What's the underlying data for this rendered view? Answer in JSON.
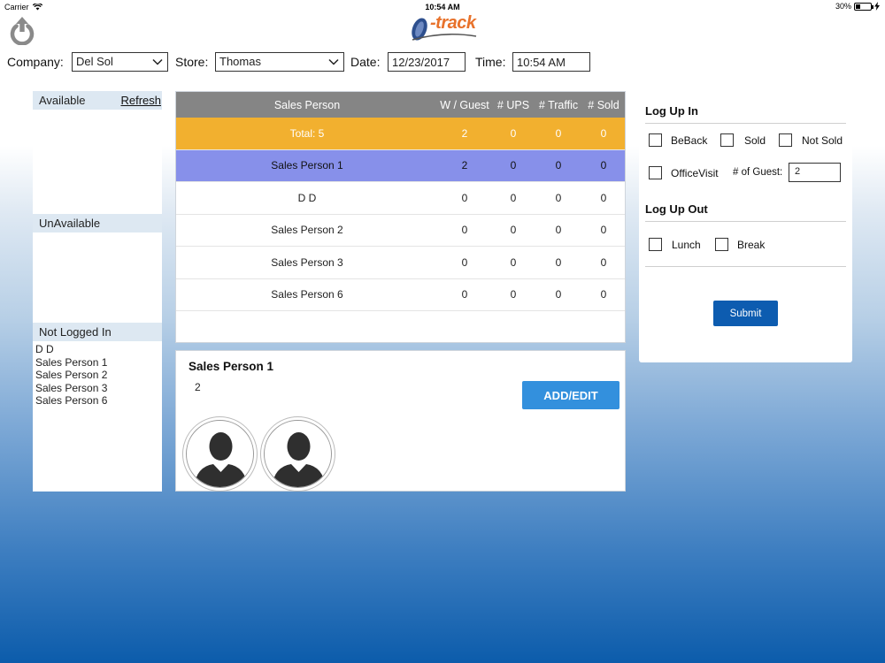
{
  "status_bar": {
    "carrier": "Carrier",
    "time": "10:54 AM",
    "battery": "30%",
    "battery_level": 0.3
  },
  "logo": {
    "text": "-track"
  },
  "filters": {
    "company_label": "Company:",
    "company_value": "Del Sol",
    "store_label": "Store:",
    "store_value": "Thomas",
    "date_label": "Date:",
    "date_value": "12/23/2017",
    "time_label": "Time:",
    "time_value": "10:54 AM"
  },
  "left_panel": {
    "available_label": "Available",
    "refresh_label": "Refresh",
    "unavailable_label": "UnAvailable",
    "not_logged_in_label": "Not Logged In",
    "not_logged_in": [
      "D D",
      "Sales Person 1",
      "Sales Person 2",
      "Sales Person 3",
      "Sales Person 6"
    ]
  },
  "table": {
    "headers": {
      "name": "Sales Person",
      "w_guest": "W / Guest",
      "ups": "# UPS",
      "traffic": "# Traffic",
      "sold": "# Sold"
    },
    "total": {
      "name": "Total: 5",
      "w_guest": "2",
      "ups": "0",
      "traffic": "0",
      "sold": "0"
    },
    "rows": [
      {
        "name": "Sales Person 1",
        "w_guest": "2",
        "ups": "0",
        "traffic": "0",
        "sold": "0"
      },
      {
        "name": "D D",
        "w_guest": "0",
        "ups": "0",
        "traffic": "0",
        "sold": "0"
      },
      {
        "name": "Sales Person 2",
        "w_guest": "0",
        "ups": "0",
        "traffic": "0",
        "sold": "0"
      },
      {
        "name": "Sales Person 3",
        "w_guest": "0",
        "ups": "0",
        "traffic": "0",
        "sold": "0"
      },
      {
        "name": "Sales Person 6",
        "w_guest": "0",
        "ups": "0",
        "traffic": "0",
        "sold": "0"
      }
    ]
  },
  "detail": {
    "title": "Sales Person 1",
    "count": "2",
    "add_edit_label": "ADD/EDIT"
  },
  "right_panel": {
    "log_up_in_label": "Log Up In",
    "beback_label": "BeBack",
    "sold_label": "Sold",
    "not_sold_label": "Not Sold",
    "office_visit_label": "OfficeVisit",
    "guest_label": "# of Guest:",
    "guest_value": "2",
    "log_up_out_label": "Log Up Out",
    "lunch_label": "Lunch",
    "break_label": "Break",
    "submit_label": "Submit"
  },
  "colors": {
    "header_gray": "#858585",
    "total_orange": "#f2b02f",
    "selected_row": "#8790ea",
    "button_blue": "#3390dd",
    "submit_blue": "#0d5cb0",
    "logo_orange": "#e8722b"
  }
}
